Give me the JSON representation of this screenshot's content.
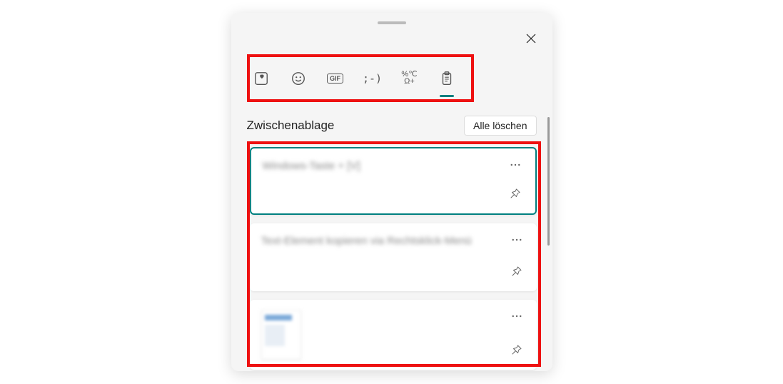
{
  "header": {
    "section_title": "Zwischenablage",
    "clear_all_label": "Alle löschen"
  },
  "tabs": {
    "recent": "recent",
    "emoji": "emoji",
    "gif_label": "GIF",
    "kaomoji_text": ";-)",
    "symbols_text": "%℃\nΩ+",
    "clipboard": "clipboard",
    "active": "clipboard"
  },
  "items": [
    {
      "type": "text",
      "text": "Windows-Taste + [V]",
      "selected": true
    },
    {
      "type": "text",
      "text": "Text-Element kopieren via Rechtsklick-Menü",
      "selected": false
    },
    {
      "type": "image",
      "selected": false
    }
  ]
}
